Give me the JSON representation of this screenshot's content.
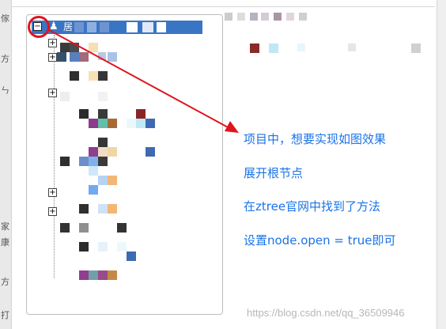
{
  "root_node": {
    "toggle_glyph": "−",
    "icon": "♟",
    "label": "居"
  },
  "child_toggles": [
    "+",
    "+",
    "+",
    "+",
    "+"
  ],
  "left_strip": [
    "傢",
    "方",
    "ㄣ",
    "家",
    "康",
    "方",
    "打"
  ],
  "annotations": [
    "项目中，想要实现如图效果",
    "展开根节点",
    "在ztree官网中找到了方法",
    "设置node.open = true即可"
  ],
  "watermark": "https://blog.csdn.net/qq_36509946",
  "colors": {
    "highlight": "#e0141e",
    "annotation": "#1a73e8",
    "selected_row": "#3a75c4"
  }
}
